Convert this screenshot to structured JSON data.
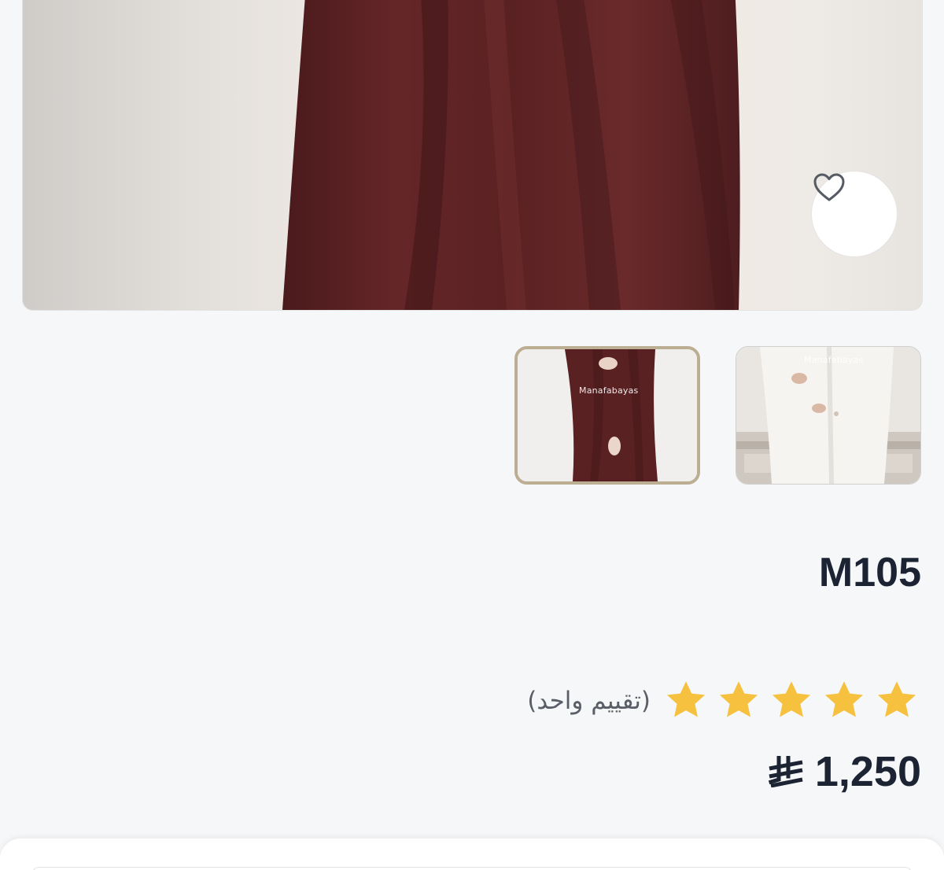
{
  "product": {
    "code": "M105",
    "rating": {
      "stars": 5,
      "max_stars": 5,
      "label": "(تقييم واحد)",
      "star_color": "#f5c13f"
    },
    "price": {
      "value": "1,250",
      "currency_icon": "saudi-riyal-icon"
    }
  },
  "gallery": {
    "thumbnails": [
      {
        "watermark": "Manafabayas",
        "selected": true,
        "color": "maroon"
      },
      {
        "watermark": "Manafabayas",
        "selected": false,
        "color": "white"
      }
    ],
    "favorite_icon": "heart-icon"
  },
  "colors": {
    "text_primary": "#1c2333",
    "selected_border": "#bcae93",
    "maroon": "#5e2324"
  }
}
